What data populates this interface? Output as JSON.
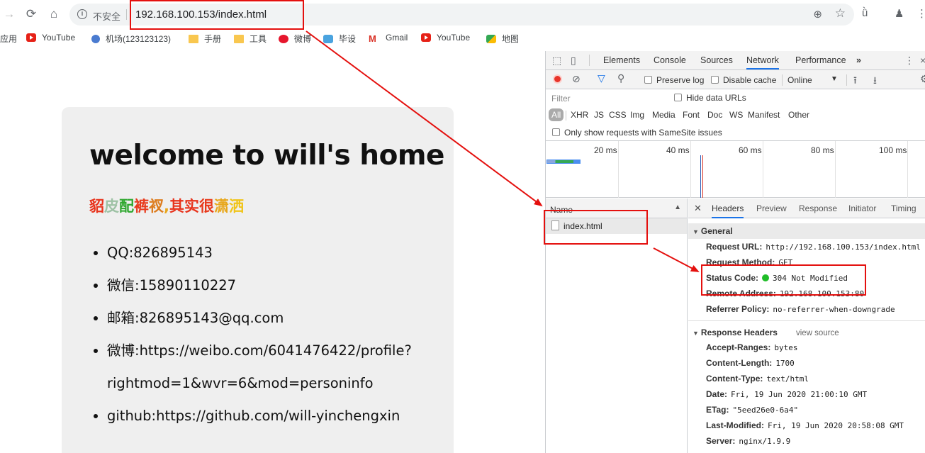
{
  "browser": {
    "insecure_label": "不安全",
    "url": "192.168.100.153/index.html"
  },
  "bookmarks": [
    {
      "label": "应用",
      "icon": "apps-icon"
    },
    {
      "label": "YouTube",
      "icon": "youtube-icon"
    },
    {
      "label": "机场(123123123)",
      "icon": "globe-icon"
    },
    {
      "label": "手册",
      "icon": "folder-icon"
    },
    {
      "label": "工具",
      "icon": "folder-icon"
    },
    {
      "label": "微博",
      "icon": "weibo-icon"
    },
    {
      "label": "毕设",
      "icon": "bishe-icon"
    },
    {
      "label": "Gmail",
      "icon": "gmail-icon"
    },
    {
      "label": "YouTube",
      "icon": "youtube-icon"
    },
    {
      "label": "地图",
      "icon": "maps-icon"
    }
  ],
  "page": {
    "title": "welcome to will's home",
    "slogan_chars": [
      "貂",
      "皮",
      "配",
      "裤",
      "衩",
      ",",
      "其",
      "实",
      "很",
      "潇",
      "洒"
    ],
    "slogan_colors": [
      "#e8331c",
      "#9ec2a5",
      "#2ea72e",
      "#e83a1c",
      "#dd7c1e",
      "#e8a71c",
      "#e8331c",
      "#e8331c",
      "#e83a1c",
      "#e8a71c",
      "#f0c419"
    ],
    "contacts": [
      "QQ:826895143",
      "微信:15890110227",
      "邮箱:826895143@qq.com",
      "微博:https://weibo.com/6041476422/profile?",
      "rightmod=1&wvr=6&mod=personinfo",
      "github:https://github.com/will-yinchengxin"
    ]
  },
  "devtools": {
    "tabs": [
      "Elements",
      "Console",
      "Sources",
      "Network",
      "Performance"
    ],
    "active_tab": "Network",
    "more_tabs": "»",
    "preserve_log": "Preserve log",
    "disable_cache": "Disable cache",
    "throttle": "Online",
    "filter_placeholder": "Filter",
    "hide_data_urls": "Hide data URLs",
    "types": [
      "All",
      "XHR",
      "JS",
      "CSS",
      "Img",
      "Media",
      "Font",
      "Doc",
      "WS",
      "Manifest",
      "Other"
    ],
    "samesite": "Only show requests with SameSite issues",
    "timeline_labels": [
      "20 ms",
      "40 ms",
      "60 ms",
      "80 ms",
      "100 ms"
    ],
    "name_header": "Name",
    "request_name": "index.html",
    "detail_tabs": [
      "Headers",
      "Preview",
      "Response",
      "Initiator",
      "Timing"
    ],
    "general_title": "General",
    "general": [
      {
        "k": "Request URL:",
        "v": "http://192.168.100.153/index.html"
      },
      {
        "k": "Request Method:",
        "v": "GET"
      },
      {
        "k": "Status Code:",
        "v": "304 Not Modified"
      },
      {
        "k": "Remote Address:",
        "v": "192.168.100.153:80"
      },
      {
        "k": "Referrer Policy:",
        "v": "no-referrer-when-downgrade"
      }
    ],
    "response_title": "Response Headers",
    "view_source": "view source",
    "response": [
      {
        "k": "Accept-Ranges:",
        "v": "bytes"
      },
      {
        "k": "Content-Length:",
        "v": "1700"
      },
      {
        "k": "Content-Type:",
        "v": "text/html"
      },
      {
        "k": "Date:",
        "v": "Fri, 19 Jun 2020 21:00:10 GMT"
      },
      {
        "k": "ETag:",
        "v": "\"5eed26e0-6a4\""
      },
      {
        "k": "Last-Modified:",
        "v": "Fri, 19 Jun 2020 20:58:08 GMT"
      },
      {
        "k": "Server:",
        "v": "nginx/1.9.9"
      }
    ]
  },
  "colors": {
    "annotation_red": "#e4100e",
    "status_ok_green": "#1fbd28",
    "accent_blue": "#1a73e8"
  }
}
